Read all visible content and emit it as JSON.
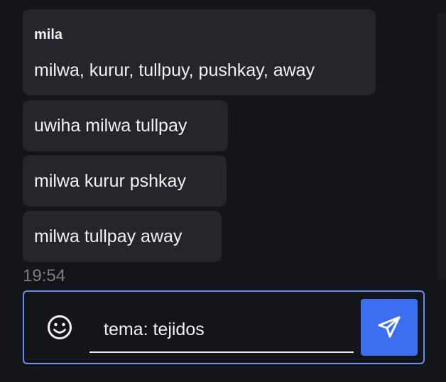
{
  "messages": [
    {
      "sender": "mila",
      "text": "milwa, kurur, tullpuy, pushkay, away"
    },
    {
      "text": "uwiha milwa tullpay"
    },
    {
      "text": "milwa kurur pshkay"
    },
    {
      "text": "milwa tullpay away"
    }
  ],
  "timestamp": "19:54",
  "composer": {
    "input_value": "tema: tejidos",
    "emoji_icon": "smiley-icon",
    "send_icon": "paper-plane-icon"
  },
  "colors": {
    "background": "#141519",
    "bubble": "#25262b",
    "accent": "#3b6ff0",
    "focus_border": "#6d8ff0"
  }
}
